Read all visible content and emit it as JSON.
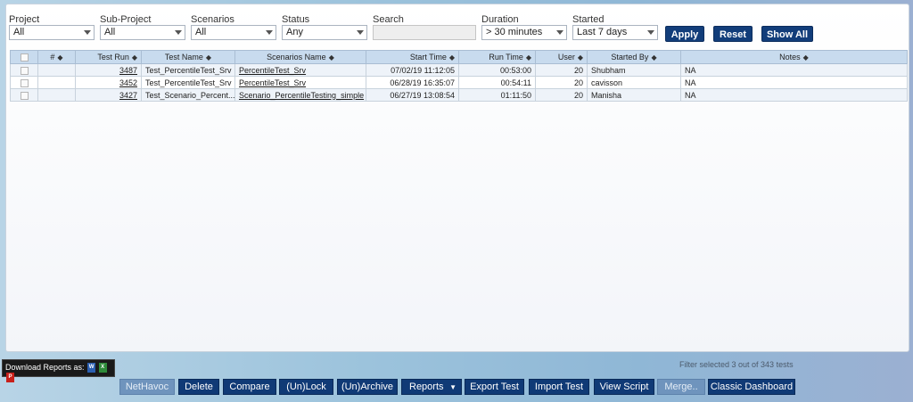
{
  "filters": {
    "project": {
      "label": "Project",
      "value": "All"
    },
    "sub_project": {
      "label": "Sub-Project",
      "value": "All"
    },
    "scenarios": {
      "label": "Scenarios",
      "value": "All"
    },
    "status": {
      "label": "Status",
      "value": "Any"
    },
    "search": {
      "label": "Search",
      "value": ""
    },
    "duration": {
      "label": "Duration",
      "value": "> 30 minutes"
    },
    "started": {
      "label": "Started",
      "value": "Last 7 days"
    }
  },
  "filter_buttons": {
    "apply": "Apply",
    "reset": "Reset",
    "show_all": "Show All"
  },
  "table": {
    "headers": {
      "num": "#",
      "test_run": "Test Run",
      "test_name": "Test Name",
      "scenario_name": "Scenarios Name",
      "start_time": "Start Time",
      "run_time": "Run Time",
      "user": "User",
      "started_by": "Started By",
      "notes": "Notes"
    },
    "rows": [
      {
        "test_run": "3487",
        "test_name": "Test_PercentileTest_Srv",
        "scenario": "PercentileTest_Srv",
        "start_time": "07/02/19 11:12:05",
        "run_time": "00:53:00",
        "user": "20",
        "started_by": "Shubham",
        "notes": "NA"
      },
      {
        "test_run": "3452",
        "test_name": "Test_PercentileTest_Srv",
        "scenario": "PercentileTest_Srv",
        "start_time": "06/28/19 16:35:07",
        "run_time": "00:54:11",
        "user": "20",
        "started_by": "cavisson",
        "notes": "NA"
      },
      {
        "test_run": "3427",
        "test_name": "Test_Scenario_Percent...",
        "scenario": "Scenario_PercentileTesting_simple",
        "start_time": "06/27/19 13:08:54",
        "run_time": "01:11:50",
        "user": "20",
        "started_by": "Manisha",
        "notes": "NA"
      }
    ]
  },
  "footer": {
    "download_label": "Download Reports as:",
    "filter_status": "Filter selected 3 out of 343 tests",
    "buttons": {
      "nethavoc": "NetHavoc",
      "delete": "Delete",
      "compare": "Compare",
      "unlock": "(Un)Lock",
      "unarchive": "(Un)Archive",
      "reports": "Reports",
      "export": "Export Test",
      "import": "Import Test",
      "view_script": "View Script",
      "merge": "Merge..",
      "classic": "Classic Dashboard"
    }
  }
}
